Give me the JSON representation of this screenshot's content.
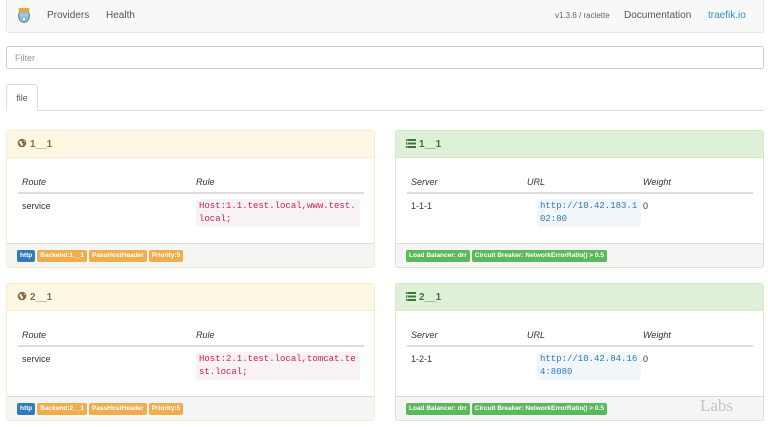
{
  "navbar": {
    "logo_icon": "traefik-gopher-logo-icon",
    "providers": "Providers",
    "health": "Health",
    "version": "v1.3.6 / raclette",
    "documentation": "Documentation",
    "brand": "traefik.io",
    "brand_color": "#2a8fd6"
  },
  "filter": {
    "placeholder": "Filter",
    "value": ""
  },
  "tabs": [
    {
      "label": "file",
      "active": true
    }
  ],
  "frontends": [
    {
      "icon": "globe-icon",
      "name": "1__1",
      "headers": {
        "route": "Route",
        "rule": "Rule"
      },
      "rows": [
        {
          "route": "service",
          "rule": "Host:1.1.test.local,www.test.local;"
        }
      ],
      "labels": [
        "http",
        "Backend:1__1",
        "PassHostHeader",
        "Priority:5"
      ]
    },
    {
      "icon": "globe-icon",
      "name": "2__1",
      "headers": {
        "route": "Route",
        "rule": "Rule"
      },
      "rows": [
        {
          "route": "service",
          "rule": "Host:2.1.test.local,tomcat.test.local;"
        }
      ],
      "labels": [
        "http",
        "Backend:2__1",
        "PassHostHeader",
        "Priority:5"
      ]
    }
  ],
  "backends": [
    {
      "icon": "server-list-icon",
      "name": "1__1",
      "headers": {
        "server": "Server",
        "url": "URL",
        "weight": "Weight"
      },
      "rows": [
        {
          "server": "1-1-1",
          "url": "http://10.42.183.102:80",
          "weight": "0"
        }
      ],
      "labels": [
        "Load Balancer: drr",
        "Circuit Breaker: NetworkErrorRatio() > 0.5"
      ]
    },
    {
      "icon": "server-list-icon",
      "name": "2__1",
      "headers": {
        "server": "Server",
        "url": "URL",
        "weight": "Weight"
      },
      "rows": [
        {
          "server": "1-2-1",
          "url": "http://10.42.84.164:8080",
          "weight": "0"
        }
      ],
      "labels": [
        "Load Balancer: drr",
        "Circuit Breaker: NetworkErrorRatio() > 0.5"
      ]
    }
  ],
  "colors": {
    "frontend_heading_bg": "#fcf8e3",
    "frontend_heading_text": "#8a6d3b",
    "backend_heading_bg": "#dff0d8",
    "backend_heading_text": "#3c763d",
    "label_primary": "#337ab7",
    "label_warning": "#f0ad4e",
    "label_success": "#5cb85c",
    "rule_code_text": "#c7254e"
  },
  "watermark": "Labs"
}
